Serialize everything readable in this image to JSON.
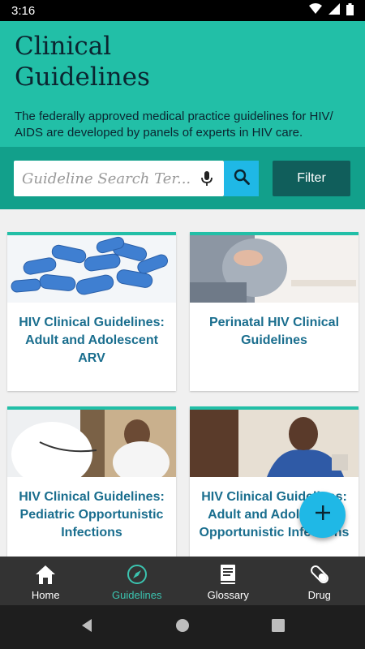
{
  "status_bar": {
    "time": "3:16"
  },
  "header": {
    "title": "Clinical Guidelines",
    "description": "The federally approved medical practice guidelines for HIV/ AIDS are developed by panels of experts in HIV care."
  },
  "search": {
    "placeholder": "Guideline Search Ter...",
    "filter_label": "Filter"
  },
  "cards": [
    {
      "title": "HIV Clinical Guidelines: Adult and Adolescent ARV",
      "image": "blue-pills"
    },
    {
      "title": "Perinatal HIV Clinical Guidelines",
      "image": "pregnant-woman"
    },
    {
      "title": "HIV Clinical Guidelines: Pediatric Opportunistic Infections",
      "image": "doctor-child"
    },
    {
      "title": "HIV Clinical Guidelines: Adult and Adolescent Opportunistic Infections",
      "image": "elderly-man"
    }
  ],
  "bottom_nav": [
    {
      "label": "Home",
      "icon": "home-icon",
      "active": false
    },
    {
      "label": "Guidelines",
      "icon": "compass-icon",
      "active": true
    },
    {
      "label": "Glossary",
      "icon": "book-icon",
      "active": false
    },
    {
      "label": "Drug",
      "icon": "pill-icon",
      "active": false
    }
  ],
  "colors": {
    "header_bg": "#22bfa7",
    "search_band_bg": "#12a08b",
    "accent_blue": "#1fb8e6",
    "filter_bg": "#105e5b",
    "card_title": "#1a6e8e",
    "nav_active": "#3bc4b0"
  }
}
